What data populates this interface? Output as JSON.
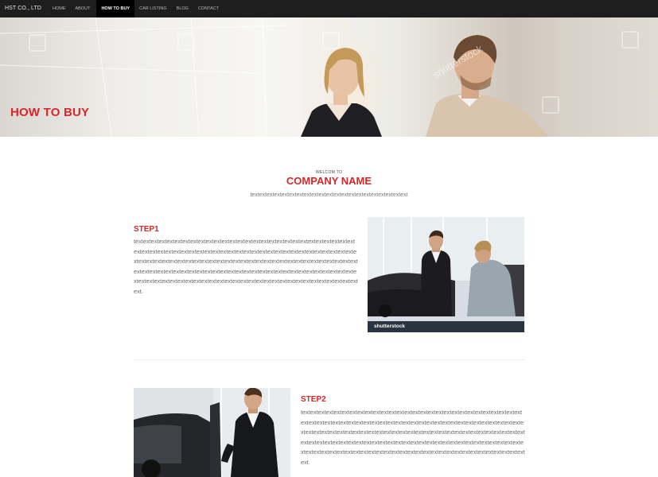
{
  "brand": "HST CO., LTD",
  "nav": {
    "home": "HOME",
    "about": "ABOUT",
    "how_to_buy": "HOW TO BUY",
    "car_listing": "CAR LISTING",
    "blog": "BLOG",
    "contact": "CONTACT"
  },
  "hero": {
    "title": "HOW TO BUY",
    "watermark": "shutterstock"
  },
  "intro": {
    "welcome": "WELCOM TO",
    "company": "COMPANY NAME",
    "text": "textextextextextextextextextextextextextextextextextextextextext"
  },
  "step1": {
    "title": "STEP1",
    "text": "textextextextextextextextextextextextextextextextextextextextextextextextextextextextextextextextextextextextextextextextextextextextextextextextextextextextextextextextextextextextextextextextextextextextextextextextextextextextextextextextextextextextextextextextextextextextextextextextextextextextextextextextextextextextextextextextextextextextextextextextextextextextextextextextextextextextextextextextextextextextextextext.",
    "photo_caption": "shutterstock"
  },
  "step2": {
    "title": "STEP2",
    "text": "textextextextextextextextextextextextextextextextextextextextextextextextextextextextextextextextextextextextextextextextextextextextextextextextextextextextextextextextextextextextextextextextextextextextextextextextextextextextextextextextextextextextextextextextextextextextextextextextextextextextextextextextextextextextextextextextextextextextextextextextextextextextextextextextextextextextextextextextextextextextextextext."
  },
  "colors": {
    "accent": "#d8262a",
    "nav_bg": "#1e1e1e"
  }
}
